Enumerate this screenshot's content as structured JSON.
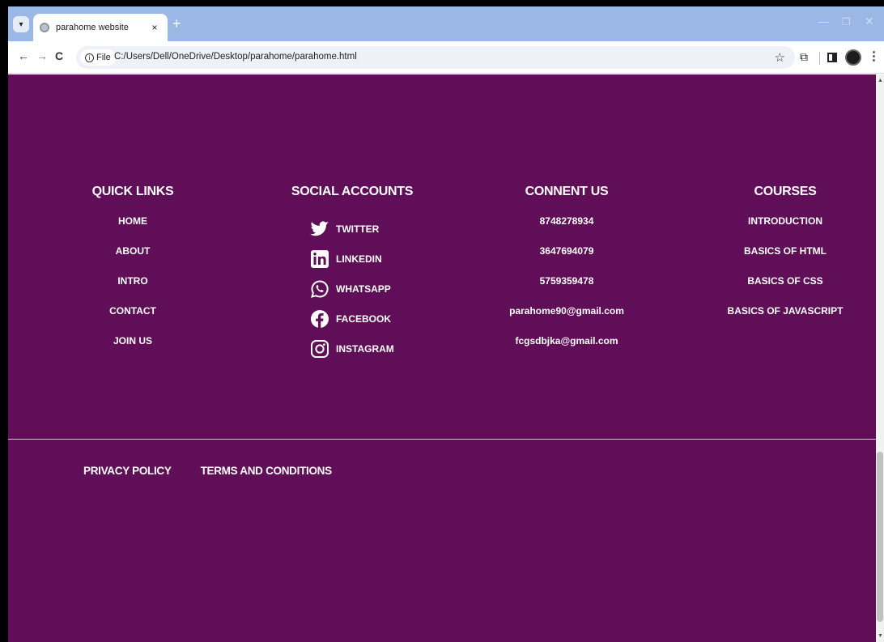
{
  "browser": {
    "tab_title": "parahome website",
    "tab_close": "×",
    "new_tab": "+",
    "chip_label": "File",
    "url": "C:/Users/Dell/OneDrive/Desktop/parahome/parahome.html"
  },
  "footer": {
    "quick_links": {
      "heading": "QUICK LINKS",
      "items": [
        "HOME",
        "ABOUT",
        "INTRO",
        "CONTACT",
        "JOIN US"
      ]
    },
    "social": {
      "heading": "SOCIAL ACCOUNTS",
      "items": [
        {
          "label": "TWITTER",
          "icon": "twitter-icon"
        },
        {
          "label": "LINKEDIN",
          "icon": "linkedin-icon"
        },
        {
          "label": "WHATSAPP",
          "icon": "whatsapp-icon"
        },
        {
          "label": "FACEBOOK",
          "icon": "facebook-icon"
        },
        {
          "label": "INSTAGRAM",
          "icon": "instagram-icon"
        }
      ]
    },
    "contact": {
      "heading": "CONNENT US",
      "items": [
        "8748278934",
        "3647694079",
        "5759359478",
        "parahome90@gmail.com",
        "fcgsdbjka@gmail.com"
      ]
    },
    "courses": {
      "heading": "COURSES",
      "items": [
        "INTRODUCTION",
        "BASICS OF HTML",
        "BASICS OF CSS",
        "BASICS OF JAVASCRIPT"
      ]
    },
    "bottom": {
      "privacy": "PRIVACY POLICY",
      "terms": "TERMS AND CONDITIONS"
    }
  },
  "colors": {
    "page_background": "#600e57",
    "text": "#ffffff",
    "tabstrip": "#9ab7e6"
  }
}
